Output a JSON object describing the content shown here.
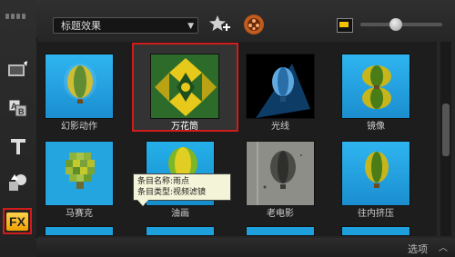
{
  "category": {
    "selected": "标题效果"
  },
  "tiles": [
    {
      "label": "幻影动作"
    },
    {
      "label": "万花筒"
    },
    {
      "label": "光线"
    },
    {
      "label": "镜像"
    },
    {
      "label": "马赛克"
    },
    {
      "label": "油画"
    },
    {
      "label": "老电影"
    },
    {
      "label": "往内挤压"
    }
  ],
  "tooltip": {
    "line1": "条目名称:雨点",
    "line2": "条目类型:视频滤镜"
  },
  "bottom": {
    "options_label": "选项"
  },
  "icons": {
    "fx": "fx-icon",
    "fav": "add-favorite-icon",
    "film": "film-reel-icon"
  },
  "colors": {
    "selection_border": "#d21c1c"
  },
  "fx_label": "FX"
}
